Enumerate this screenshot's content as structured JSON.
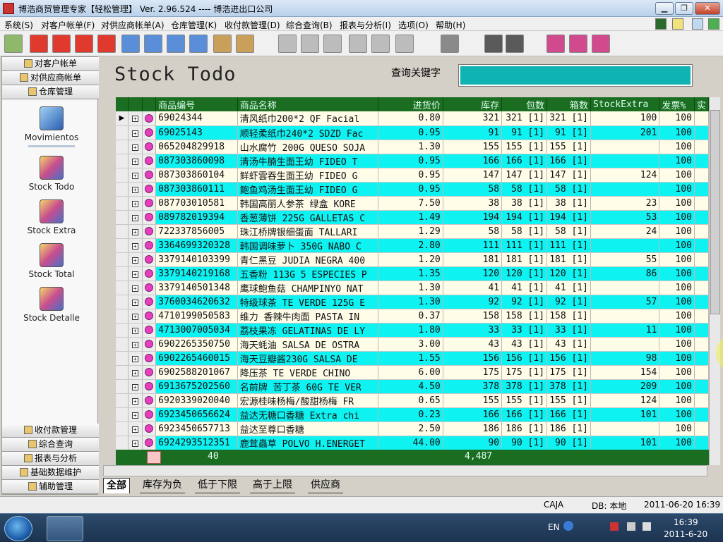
{
  "window": {
    "title": "博浩商贸管理专家【轻松管理】 Ver. 2.96.524 ---- 博浩进出口公司",
    "btn_min": "▁",
    "btn_max": "❐",
    "btn_close": "✕"
  },
  "menu": [
    "系统(S)",
    "对客户帐单(F)",
    "对供应商帐单(A)",
    "仓库管理(K)",
    "收付款管理(D)",
    "综合查询(B)",
    "报表与分析(I)",
    "选项(O)",
    "帮助(H)"
  ],
  "sidebar": {
    "top_headers": [
      "对客户帐单",
      "对供应商帐单",
      "仓库管理"
    ],
    "items": [
      "Movimientos",
      "Stock Todo",
      "Stock Extra",
      "Stock Total",
      "Stock Detalle"
    ],
    "bottom_headers": [
      "收付款管理",
      "综合查询",
      "报表与分析",
      "基础数据维护",
      "辅助管理"
    ]
  },
  "content": {
    "title": "Stock Todo",
    "search_label": "查询关键字",
    "search_value": ""
  },
  "grid": {
    "columns": [
      "商品编号",
      "商品名称",
      "进货价",
      "库存",
      "包数",
      "箱数",
      "StockExtra",
      "发票%",
      "实"
    ],
    "rows": [
      [
        "69024344",
        "清风纸巾200*2 QF Facial",
        "0.80",
        "321",
        "321 [1]",
        "321 [1]",
        "100",
        "100"
      ],
      [
        "69025143",
        "顺轻柔纸巾240*2 SDZD Fac",
        "0.95",
        "91",
        "91 [1]",
        "91 [1]",
        "201",
        "100"
      ],
      [
        "065204829918",
        "山水腐竹 200G QUESO SOJA",
        "1.30",
        "155",
        "155 [1]",
        "155 [1]",
        "",
        "100"
      ],
      [
        "087303860098",
        "清汤牛腩生面王幼 FIDEO T",
        "0.95",
        "166",
        "166 [1]",
        "166 [1]",
        "",
        "100"
      ],
      [
        "087303860104",
        "鲜虾雲吞生面王幼 FIDEO G",
        "0.95",
        "147",
        "147 [1]",
        "147 [1]",
        "124",
        "100"
      ],
      [
        "087303860111",
        "鲍鱼鸡汤生面王幼 FIDEO G",
        "0.95",
        "58",
        "58 [1]",
        "58 [1]",
        "",
        "100"
      ],
      [
        "087703010581",
        "韩国高丽人参茶 绿盒 KORE",
        "7.50",
        "38",
        "38 [1]",
        "38 [1]",
        "23",
        "100"
      ],
      [
        "089782019394",
        "香葱薄饼 225G GALLETAS C",
        "1.49",
        "194",
        "194 [1]",
        "194 [1]",
        "53",
        "100"
      ],
      [
        "722337856005",
        "珠江桥牌银细蛋面 TALLARI",
        "1.29",
        "58",
        "58 [1]",
        "58 [1]",
        "24",
        "100"
      ],
      [
        "3364699320328",
        "韩国调味萝卜 350G NABO C",
        "2.80",
        "111",
        "111 [1]",
        "111 [1]",
        "",
        "100"
      ],
      [
        "3379140103399",
        "青仁黑豆 JUDIA NEGRA 400",
        "1.20",
        "181",
        "181 [1]",
        "181 [1]",
        "55",
        "100"
      ],
      [
        "3379140219168",
        "五香粉 113G 5 ESPECIES P",
        "1.35",
        "120",
        "120 [1]",
        "120 [1]",
        "86",
        "100"
      ],
      [
        "3379140501348",
        "鹰球鲍鱼菇 CHAMPINYO NAT",
        "1.30",
        "41",
        "41 [1]",
        "41 [1]",
        "",
        "100"
      ],
      [
        "3760034620632",
        "特级球茶 TE VERDE 125G E",
        "1.30",
        "92",
        "92 [1]",
        "92 [1]",
        "57",
        "100"
      ],
      [
        "4710199050583",
        "维力 香辣牛肉面 PASTA IN",
        "0.37",
        "158",
        "158 [1]",
        "158 [1]",
        "",
        "100"
      ],
      [
        "4713007005034",
        "荔枝果冻 GELATINAS DE LY",
        "1.80",
        "33",
        "33 [1]",
        "33 [1]",
        "11",
        "100"
      ],
      [
        "6902265350750",
        "海天蚝油 SALSA DE OSTRA",
        "3.00",
        "43",
        "43 [1]",
        "43 [1]",
        "",
        "100"
      ],
      [
        "6902265460015",
        "海天豆瓣酱230G SALSA DE",
        "1.55",
        "156",
        "156 [1]",
        "156 [1]",
        "98",
        "100"
      ],
      [
        "6902588201067",
        "降压茶 TE VERDE CHINO",
        "6.00",
        "175",
        "175 [1]",
        "175 [1]",
        "154",
        "100"
      ],
      [
        "6913675202560",
        "名前牌 苦丁茶 60G TE VER",
        "4.50",
        "378",
        "378 [1]",
        "378 [1]",
        "209",
        "100"
      ],
      [
        "6920339020040",
        "宏源桂味杨梅/酸甜杨梅 FR",
        "0.65",
        "155",
        "155 [1]",
        "155 [1]",
        "124",
        "100"
      ],
      [
        "6923450656624",
        "益达无糖口香糖 Extra chi",
        "0.23",
        "166",
        "166 [1]",
        "166 [1]",
        "101",
        "100"
      ],
      [
        "6923450657713",
        "益达至尊口香糖",
        "2.50",
        "186",
        "186 [1]",
        "186 [1]",
        "",
        "100"
      ],
      [
        "6924293512351",
        "鹿茸蟲草 POLVO H.ENERGET",
        "44.00",
        "90",
        "90 [1]",
        "90 [1]",
        "101",
        "100"
      ]
    ],
    "footer_count": "40",
    "footer_stock_total": "4,487"
  },
  "tabs": [
    "全部",
    "库存为负",
    "低于下限",
    "高于上限",
    "供应商"
  ],
  "status": {
    "user": "CAJA",
    "db": "DB: 本地",
    "datetime": "2011-06-20 16:39"
  },
  "taskbar": {
    "lang": "EN",
    "clock_time": "16:39",
    "clock_date": "2011-6-20"
  }
}
